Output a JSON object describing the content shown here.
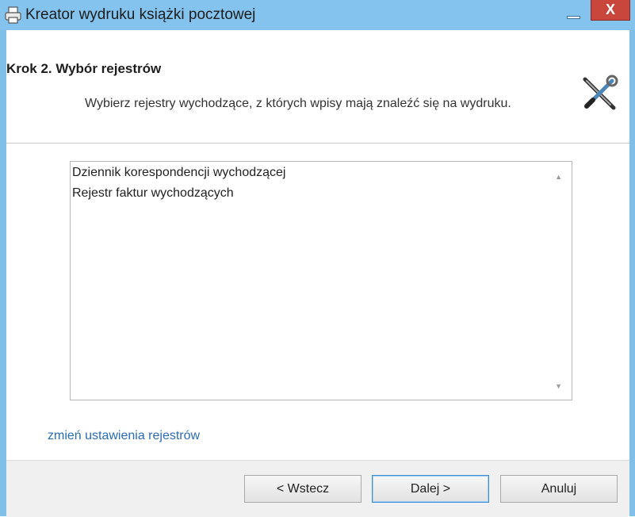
{
  "window": {
    "title": "Kreator wydruku książki pocztowej",
    "close_glyph": "X"
  },
  "header": {
    "step_title": "Krok 2. Wybór rejestrów",
    "step_description": "Wybierz rejestry wychodzące, z których wpisy mają znaleźć się na wydruku."
  },
  "registers": {
    "items": [
      "Dziennik korespondencji wychodzącej",
      "Rejestr faktur wychodzących"
    ]
  },
  "links": {
    "change_settings": "zmień ustawienia rejestrów"
  },
  "buttons": {
    "back": "< Wstecz",
    "next": "Dalej >",
    "cancel": "Anuluj"
  },
  "colors": {
    "titlebar": "#83c3ee",
    "close_button": "#c9463d",
    "link": "#2a6cb5"
  },
  "icons": {
    "title": "printer-icon",
    "header": "tools-icon"
  }
}
